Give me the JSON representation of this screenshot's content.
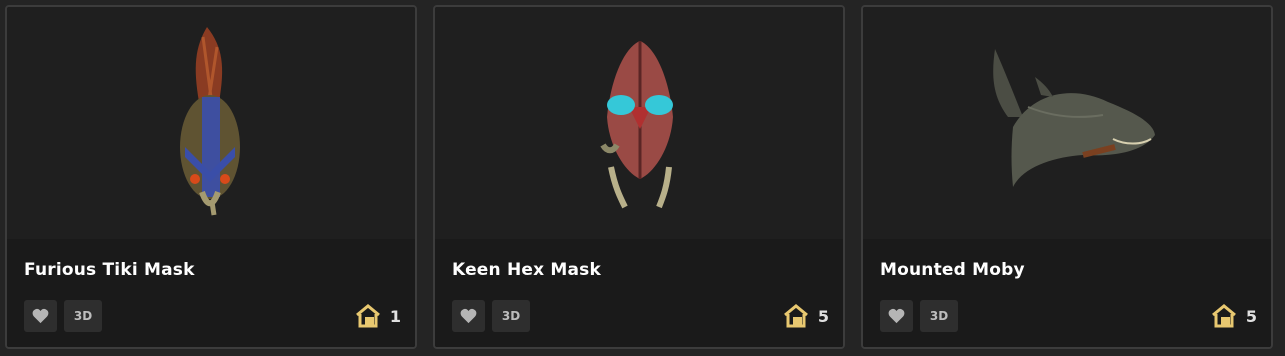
{
  "items": [
    {
      "name": "Furious Tiki Mask",
      "badge": "3D",
      "count": "1"
    },
    {
      "name": "Keen Hex Mask",
      "badge": "3D",
      "count": "5"
    },
    {
      "name": "Mounted Moby",
      "badge": "3D",
      "count": "5"
    }
  ],
  "colors": {
    "card_bg": "#1f1f1f",
    "info_bg": "#1a1a1a",
    "house_icon": "#e8c870"
  }
}
